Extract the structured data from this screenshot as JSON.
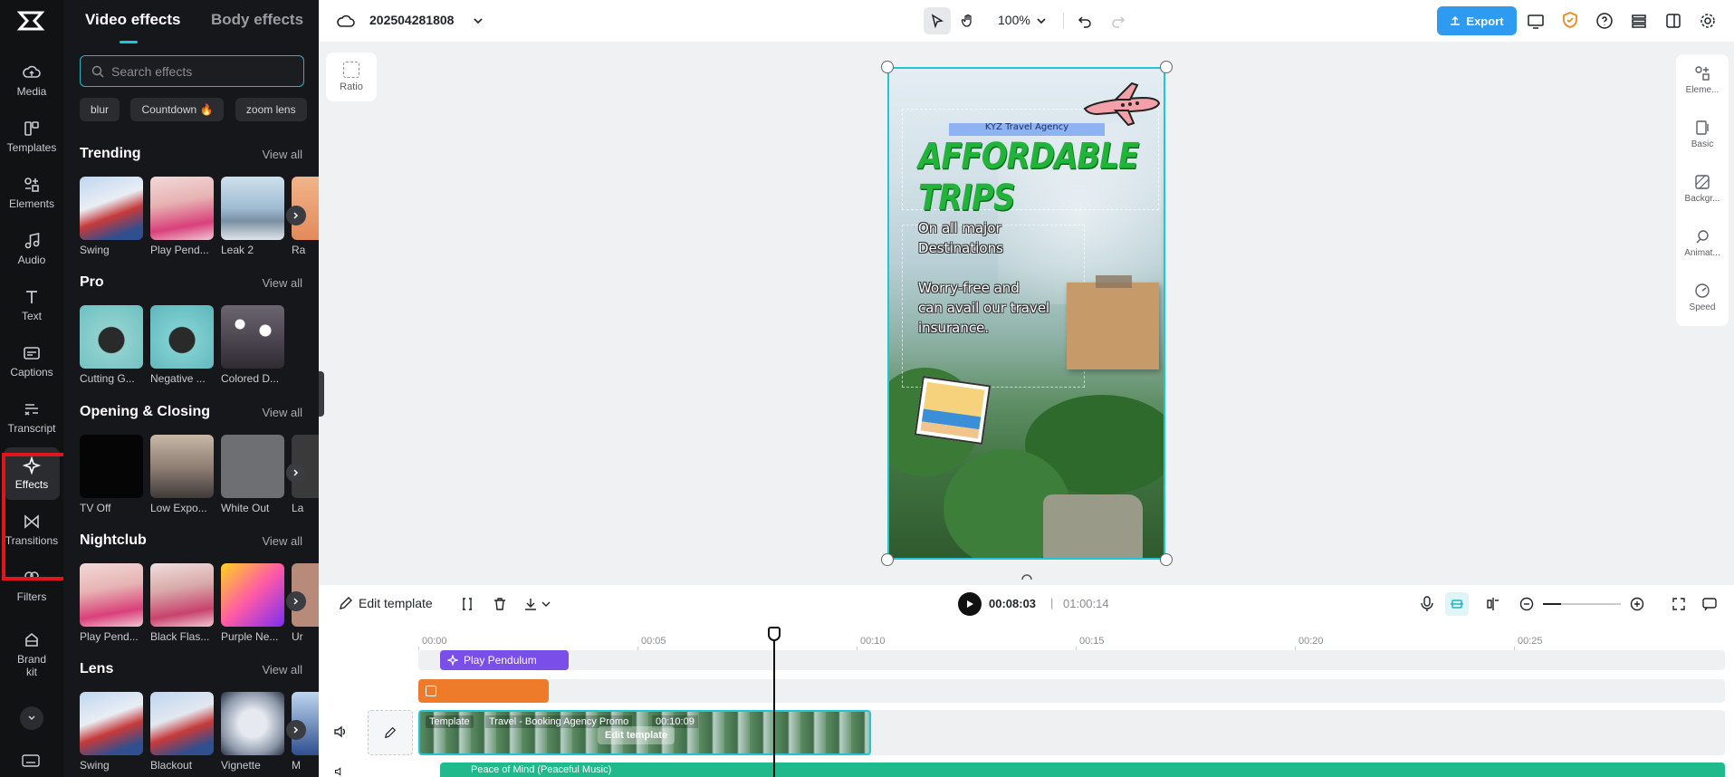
{
  "rail": {
    "items": [
      {
        "label": "Media",
        "icon": "cloud-icon"
      },
      {
        "label": "Templates",
        "icon": "templates-icon"
      },
      {
        "label": "Elements",
        "icon": "elements-icon"
      },
      {
        "label": "Audio",
        "icon": "music-note-icon"
      },
      {
        "label": "Text",
        "icon": "text-icon"
      },
      {
        "label": "Captions",
        "icon": "captions-icon"
      },
      {
        "label": "Transcript",
        "icon": "transcript-icon"
      },
      {
        "label": "Effects",
        "icon": "sparkle-icon"
      },
      {
        "label": "Transitions",
        "icon": "bowtie-icon"
      },
      {
        "label": "Filters",
        "icon": "filters-icon"
      },
      {
        "label": "Brand kit",
        "icon": "brand-kit-icon"
      }
    ],
    "active": "Effects",
    "highlight_color": "#e0161b"
  },
  "panel": {
    "tabs": [
      "Video effects",
      "Body effects"
    ],
    "search_placeholder": "Search effects",
    "chips": [
      "blur",
      "Countdown 🔥",
      "zoom lens"
    ],
    "view_all": "View all",
    "sections": [
      {
        "title": "Trending",
        "items": [
          "Swing",
          "Play Pend...",
          "Leak 2",
          "Ra"
        ]
      },
      {
        "title": "Pro",
        "items": [
          "Cutting G...",
          "Negative ...",
          "Colored D..."
        ]
      },
      {
        "title": "Opening & Closing",
        "items": [
          "TV Off",
          "Low Expo...",
          "White Out",
          "La"
        ]
      },
      {
        "title": "Nightclub",
        "items": [
          "Play Pend...",
          "Black Flas...",
          "Purple Ne...",
          "Ur"
        ]
      },
      {
        "title": "Lens",
        "items": [
          "Swing",
          "Blackout",
          "Vignette",
          "M"
        ]
      }
    ]
  },
  "topbar": {
    "project_name": "202504281808",
    "zoom": "100%",
    "export_label": "Export",
    "accent": "#2e9bf0"
  },
  "canvas": {
    "ratio_label": "Ratio",
    "agency": "KYZ Travel Agency",
    "headline": "AFFORDABLE TRIPS",
    "line1": "On all major",
    "line2": "Destinations",
    "line3": "Worry-free and",
    "line4": "can avail our travel",
    "line5": "insurance."
  },
  "right_rail": {
    "items": [
      "Eleme...",
      "Basic",
      "Backgr...",
      "Animat...",
      "Speed"
    ]
  },
  "timeline": {
    "edit_template": "Edit template",
    "current_time": "00:08:03",
    "separator": "|",
    "total_time": "01:00:14",
    "ruler": [
      "00:00",
      "00:05",
      "00:10",
      "00:15",
      "00:20",
      "00:25"
    ],
    "effect_clip": "Play Pendulum",
    "video_label": "Template",
    "video_title": "Travel - Booking Agency Promo",
    "video_duration": "00:10:09",
    "video_edit": "Edit template",
    "audio_clip": "Peace of Mind (Peaceful Music)"
  }
}
